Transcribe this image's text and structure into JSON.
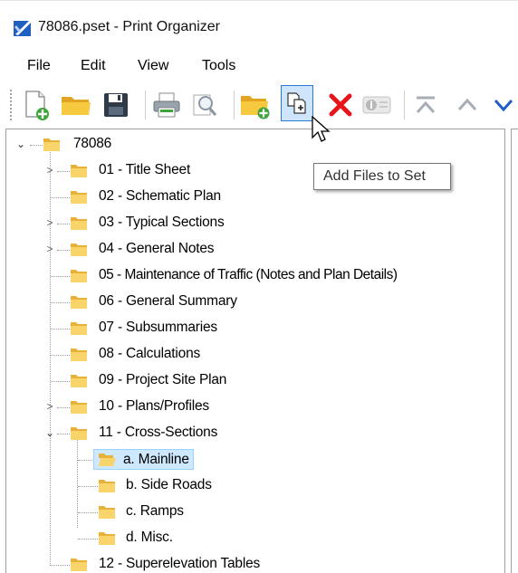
{
  "window": {
    "title": "78086.pset - Print Organizer"
  },
  "menu": {
    "file": "File",
    "edit": "Edit",
    "view": "View",
    "tools": "Tools"
  },
  "toolbar": {
    "buttons": [
      "new-set-icon",
      "open-folder-icon",
      "save-icon",
      "print-icon",
      "preview-icon",
      "new-folder-icon",
      "add-files-icon",
      "delete-icon",
      "properties-icon",
      "move-top-icon",
      "move-up-icon",
      "move-down-icon"
    ],
    "tooltip": "Add Files to Set"
  },
  "tree": {
    "root": "78086",
    "items": [
      {
        "label": "01 - Title Sheet",
        "expandable": true,
        "expanded": false
      },
      {
        "label": "02 - Schematic Plan",
        "expandable": false
      },
      {
        "label": "03 - Typical Sections",
        "expandable": true,
        "expanded": false
      },
      {
        "label": "04 - General Notes",
        "expandable": true,
        "expanded": false
      },
      {
        "label": "05 - Maintenance of Traffic (Notes and Plan Details)",
        "expandable": false
      },
      {
        "label": "06 - General Summary",
        "expandable": false
      },
      {
        "label": "07 - Subsummaries",
        "expandable": false
      },
      {
        "label": "08 - Calculations",
        "expandable": false
      },
      {
        "label": "09 - Project Site Plan",
        "expandable": false
      },
      {
        "label": "10 - Plans/Profiles",
        "expandable": true,
        "expanded": false
      },
      {
        "label": "11 - Cross-Sections",
        "expandable": true,
        "expanded": true,
        "children": [
          {
            "label": "a. Mainline",
            "selected": true
          },
          {
            "label": "b. Side Roads"
          },
          {
            "label": "c. Ramps"
          },
          {
            "label": "d. Misc."
          }
        ]
      },
      {
        "label": "12 - Superelevation Tables",
        "expandable": false
      }
    ]
  },
  "colors": {
    "folder": "#f5c94d",
    "selection": "#cde8ff",
    "delete_red": "#e8141c",
    "accent_blue": "#2a7bd3"
  }
}
